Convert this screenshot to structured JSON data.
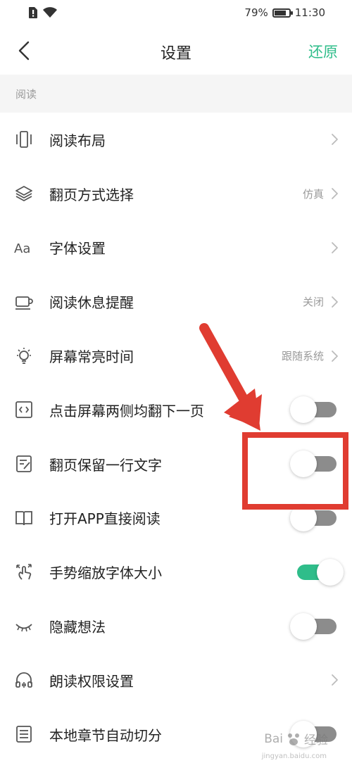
{
  "status": {
    "battery": "79%",
    "battery_level": 0.79,
    "time": "11:30"
  },
  "header": {
    "title": "设置",
    "restore": "还原"
  },
  "section": {
    "title": "阅读"
  },
  "items": [
    {
      "label": "阅读布局",
      "value": "",
      "control": "chevron",
      "icon": "layout-icon"
    },
    {
      "label": "翻页方式选择",
      "value": "仿真",
      "control": "chevron",
      "icon": "layers-icon"
    },
    {
      "label": "字体设置",
      "value": "",
      "control": "chevron",
      "icon": "font-icon"
    },
    {
      "label": "阅读休息提醒",
      "value": "关闭",
      "control": "chevron",
      "icon": "cup-icon"
    },
    {
      "label": "屏幕常亮时间",
      "value": "跟随系统",
      "control": "chevron",
      "icon": "bulb-icon"
    },
    {
      "label": "点击屏幕两侧均翻下一页",
      "value": "",
      "control": "toggle",
      "on": false,
      "icon": "code-icon"
    },
    {
      "label": "翻页保留一行文字",
      "value": "",
      "control": "toggle",
      "on": false,
      "icon": "note-icon"
    },
    {
      "label": "打开APP直接阅读",
      "value": "",
      "control": "toggle",
      "on": false,
      "icon": "book-icon"
    },
    {
      "label": "手势缩放字体大小",
      "value": "",
      "control": "toggle",
      "on": true,
      "icon": "gesture-icon"
    },
    {
      "label": "隐藏想法",
      "value": "",
      "control": "toggle",
      "on": false,
      "icon": "eye-closed-icon"
    },
    {
      "label": "朗读权限设置",
      "value": "",
      "control": "chevron",
      "icon": "headphones-icon"
    },
    {
      "label": "本地章节自动切分",
      "value": "",
      "control": "toggle",
      "on": false,
      "icon": "list-icon"
    }
  ],
  "watermark": {
    "text": "Bai",
    "text2": "经验",
    "sub": "jingyan.baidu.com"
  },
  "colors": {
    "accent": "#2fbd8a",
    "annotation": "#e03c31"
  }
}
